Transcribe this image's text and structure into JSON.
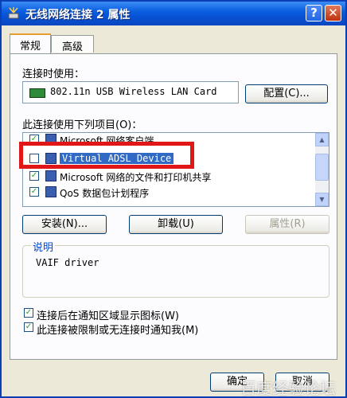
{
  "window": {
    "title": "无线网络连接 2 属性",
    "help": "?",
    "close": "✕"
  },
  "tabs": [
    {
      "label": "常规",
      "active": true
    },
    {
      "label": "高级",
      "active": false
    }
  ],
  "connect_using": {
    "label": "连接时使用：",
    "adapter": "802.11n USB Wireless LAN Card",
    "configure": "配置(C)..."
  },
  "components": {
    "label": "此连接使用下列项目(O)：",
    "items": [
      {
        "label": "Microsoft 网络客户端",
        "checked": true
      },
      {
        "label": "Virtual ADSL Device",
        "checked": false,
        "selected": true
      },
      {
        "label": "Microsoft 网络的文件和打印机共享",
        "checked": true
      },
      {
        "label": "QoS 数据包计划程序",
        "checked": true
      }
    ]
  },
  "buttons": {
    "install": "安装(N)...",
    "uninstall": "卸载(U)",
    "properties": "属性(R)"
  },
  "description": {
    "title": "说明",
    "text": "VAIF driver"
  },
  "checkboxes": [
    {
      "label": "连接后在通知区域显示图标(W)",
      "checked": true
    },
    {
      "label": "此连接被限制或无连接时通知我(M)",
      "checked": true
    }
  ],
  "footer": {
    "ok": "确定",
    "cancel": "取消"
  },
  "watermark": "百度经验论坛"
}
